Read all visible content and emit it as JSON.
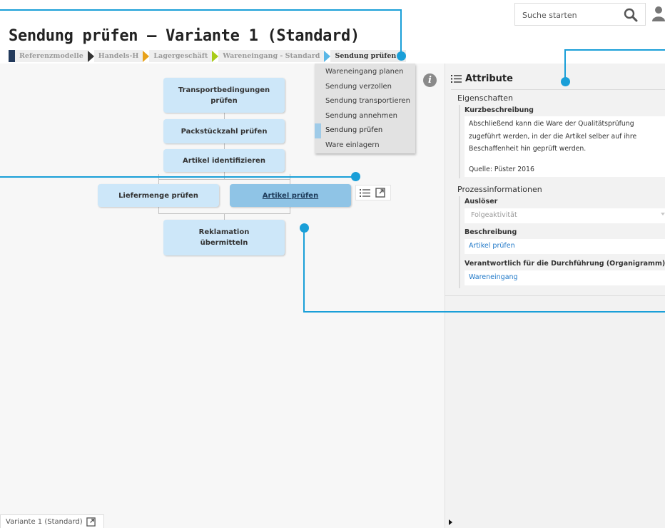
{
  "header": {
    "title": "Sendung prüfen – Variante 1 (Standard)",
    "search": {
      "placeholder": "Suche starten"
    },
    "icons": {
      "search": "search-icon",
      "user": "user-icon"
    }
  },
  "breadcrumb": {
    "items": [
      {
        "label": "Referenzmodelle"
      },
      {
        "label": "Handels-H"
      },
      {
        "label": "Lagergeschäft"
      },
      {
        "label": "Wareneingang - Standard"
      },
      {
        "label": "Sendung prüfen"
      }
    ],
    "colors": [
      "#233a5c",
      "#333333",
      "#e8a21a",
      "#a9cc1a",
      "#5ab7e6"
    ]
  },
  "step_dropdown": {
    "items": [
      {
        "label": "Wareneingang planen",
        "active": false
      },
      {
        "label": "Sendung verzollen",
        "active": false
      },
      {
        "label": "Sendung transportieren",
        "active": false
      },
      {
        "label": "Sendung annehmen",
        "active": false
      },
      {
        "label": "Sendung prüfen",
        "active": true
      },
      {
        "label": "Ware einlagern",
        "active": false
      }
    ]
  },
  "diagram": {
    "nodes": [
      {
        "line1": "Transportbedingungen",
        "line2": "prüfen"
      },
      {
        "line1": "Packstückzahl prüfen",
        "line2": ""
      },
      {
        "line1": "Artikel identifizieren",
        "line2": ""
      },
      {
        "line1": "Liefermenge prüfen",
        "line2": ""
      },
      {
        "line1": "Artikel prüfen",
        "line2": "",
        "selected": true
      },
      {
        "line1": "Reklamation",
        "line2": "übermitteln"
      }
    ],
    "node_color": "#cde7f9",
    "selected_color": "#8fc4e6",
    "info_icon": "i"
  },
  "variant_tab": {
    "label": "Variante 1 (Standard)"
  },
  "attributes": {
    "title": "Attribute",
    "eigenschaften": {
      "title": "Eigenschaften",
      "kurzbeschreibung_label": "Kurzbeschreibung",
      "text_lines": [
        "Abschließend kann die Ware der Qualitätsprüfung",
        "zugeführt werden, in der die Artikel selber auf ihre",
        "Beschaffenheit hin geprüft werden."
      ],
      "source": "Quelle: Püster 2016"
    },
    "prozessinformationen": {
      "title": "Prozessinformationen",
      "ausloeser_label": "Auslöser",
      "ausloeser_value": "Folgeaktivität",
      "beschreibung_label": "Beschreibung",
      "beschreibung_value": "Artikel prüfen",
      "verantwortlich_label": "Verantwortlich für die Durchführung (Organigramm)",
      "verantwortlich_value": "Wareneingang"
    }
  },
  "colors": {
    "accent": "#1a9fd8",
    "link": "#1f78c8",
    "panel_bg": "#f2f2f2",
    "canvas_bg": "#f7f7f7"
  }
}
